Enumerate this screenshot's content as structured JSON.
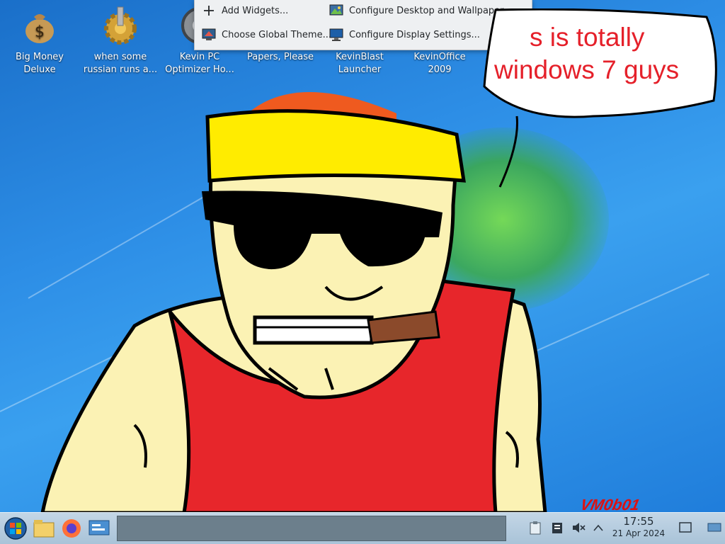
{
  "desktop": {
    "icons": [
      {
        "label": "Big Money Deluxe",
        "icon": "money-bag-icon"
      },
      {
        "label": "when some russian runs a...",
        "icon": "gear-icon"
      },
      {
        "label": "Kevin PC Optimizer Ho...",
        "icon": "optimizer-icon"
      },
      {
        "label": "Papers, Please",
        "icon": "document-icon"
      },
      {
        "label": "KevinBlast Launcher",
        "icon": "launcher-icon"
      },
      {
        "label": "KevinOffice 2009",
        "icon": "office-icon"
      }
    ]
  },
  "context_menu": {
    "items": [
      {
        "label": "Add Widgets...",
        "icon": "plus-icon"
      },
      {
        "label": "Configure Desktop and Wallpaper...",
        "icon": "wallpaper-settings-icon"
      },
      {
        "label": "Choose Global Theme...",
        "icon": "theme-icon"
      },
      {
        "label": "Configure Display Settings...",
        "icon": "display-settings-icon"
      }
    ],
    "close_icon": "close-icon"
  },
  "wallpaper": {
    "bubble_lines": [
      "s is totally",
      "windows 7 guys"
    ],
    "signature": "VM0b01",
    "text_color": "#e5202a"
  },
  "taskbar": {
    "launchers": [
      "start-orb-icon",
      "file-manager-icon",
      "firefox-icon",
      "control-panel-icon"
    ],
    "tray": [
      "clipboard-icon",
      "notes-icon",
      "volume-muted-icon",
      "show-hidden-icon"
    ],
    "clock": {
      "time": "17:55",
      "date": "21 Apr 2024"
    },
    "show_desktop_icon": "show-desktop-icon",
    "end_icon": "network-icon"
  }
}
